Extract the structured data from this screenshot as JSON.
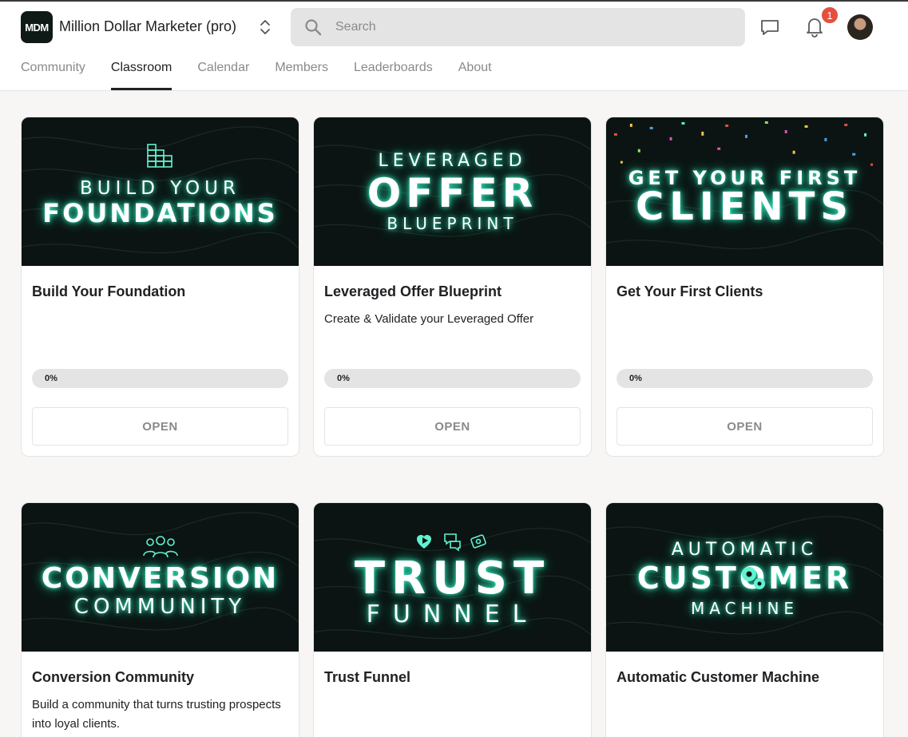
{
  "header": {
    "logo_text": "MDM",
    "group_name": "Million Dollar Marketer (pro)",
    "search_placeholder": "Search",
    "notification_count": "1",
    "accent_color": "#5ef3d0",
    "badge_color": "#e3503e"
  },
  "tabs": [
    {
      "label": "Community",
      "active": false
    },
    {
      "label": "Classroom",
      "active": true
    },
    {
      "label": "Calendar",
      "active": false
    },
    {
      "label": "Members",
      "active": false
    },
    {
      "label": "Leaderboards",
      "active": false
    },
    {
      "label": "About",
      "active": false
    }
  ],
  "courses": [
    {
      "banner_line1": "BUILD YOUR",
      "banner_line2": "FOUNDATIONS",
      "banner_icon": "brick-wall-icon",
      "title": "Build Your Foundation",
      "description": "",
      "progress_label": "0%",
      "progress": 0,
      "button": "OPEN"
    },
    {
      "banner_line1": "LEVERAGED",
      "banner_line2": "OFFER",
      "banner_line3": "BLUEPRINT",
      "title": "Leveraged Offer Blueprint",
      "description": "Create & Validate your Leveraged Offer",
      "progress_label": "0%",
      "progress": 0,
      "button": "OPEN"
    },
    {
      "banner_line1": "GET YOUR FIRST",
      "banner_line2": "CLIENTS",
      "banner_icon": "confetti-icon",
      "title": "Get Your First Clients",
      "description": "",
      "progress_label": "0%",
      "progress": 0,
      "button": "OPEN"
    },
    {
      "banner_line1": "CONVERSION",
      "banner_line2": "COMMUNITY",
      "banner_icon": "people-group-icon",
      "title": "Conversion Community",
      "description": "Build a community that turns trusting prospects into loyal clients."
    },
    {
      "banner_line1": "TRUST",
      "banner_line2": "FUNNEL",
      "banner_icon": "heart-chat-money-icons",
      "title": "Trust Funnel",
      "description": ""
    },
    {
      "banner_line1": "AUTOMATIC",
      "banner_line2": "CUSTOMER",
      "banner_line3": "MACHINE",
      "banner_icon": "gears-icon",
      "title": "Automatic Customer Machine",
      "description": ""
    }
  ]
}
